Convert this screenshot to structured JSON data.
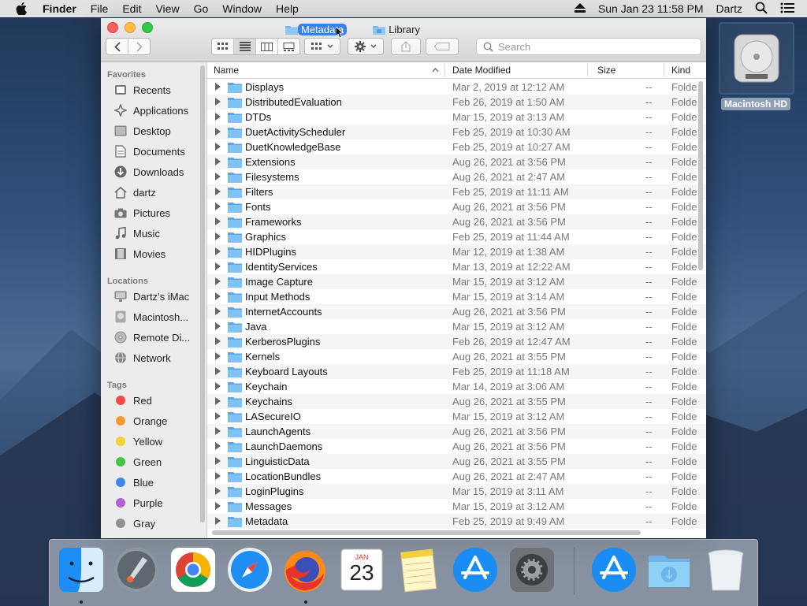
{
  "menubar": {
    "app": "Finder",
    "items": [
      "File",
      "Edit",
      "View",
      "Go",
      "Window",
      "Help"
    ],
    "clock": "Sun Jan 23  11:58 PM",
    "user": "Dartz"
  },
  "desktop": {
    "disk_label": "Macintosh HD"
  },
  "window": {
    "tabs": [
      {
        "label": "Metadata",
        "selected": true
      },
      {
        "label": "Library",
        "selected": false
      }
    ],
    "search_placeholder": "Search",
    "sidebar": {
      "favorites_header": "Favorites",
      "favorites": [
        {
          "label": "Recents",
          "icon": "clock-icon"
        },
        {
          "label": "Applications",
          "icon": "applications-icon"
        },
        {
          "label": "Desktop",
          "icon": "desktop-icon"
        },
        {
          "label": "Documents",
          "icon": "document-icon"
        },
        {
          "label": "Downloads",
          "icon": "download-icon"
        },
        {
          "label": "dartz",
          "icon": "home-icon"
        },
        {
          "label": "Pictures",
          "icon": "camera-icon"
        },
        {
          "label": "Music",
          "icon": "music-icon"
        },
        {
          "label": "Movies",
          "icon": "film-icon"
        }
      ],
      "locations_header": "Locations",
      "locations": [
        {
          "label": "Dartz’s iMac",
          "icon": "imac-icon"
        },
        {
          "label": "Macintosh...",
          "icon": "disk-icon"
        },
        {
          "label": "Remote Di...",
          "icon": "disc-icon"
        },
        {
          "label": "Network",
          "icon": "globe-icon"
        }
      ],
      "tags_header": "Tags",
      "tags": [
        {
          "label": "Red",
          "color": "#f64a4a"
        },
        {
          "label": "Orange",
          "color": "#f79a32"
        },
        {
          "label": "Yellow",
          "color": "#f4d232"
        },
        {
          "label": "Green",
          "color": "#48c342"
        },
        {
          "label": "Blue",
          "color": "#3f86f0"
        },
        {
          "label": "Purple",
          "color": "#b65ed6"
        },
        {
          "label": "Gray",
          "color": "#8f8f8f"
        }
      ]
    },
    "columns": {
      "name": "Name",
      "date": "Date Modified",
      "size": "Size",
      "kind": "Kind"
    },
    "files": [
      {
        "name": "Displays",
        "date": "Mar 2, 2019 at 12:12 AM",
        "size": "--",
        "kind": "Folde"
      },
      {
        "name": "DistributedEvaluation",
        "date": "Feb 26, 2019 at 1:50 AM",
        "size": "--",
        "kind": "Folde"
      },
      {
        "name": "DTDs",
        "date": "Mar 15, 2019 at 3:13 AM",
        "size": "--",
        "kind": "Folde"
      },
      {
        "name": "DuetActivityScheduler",
        "date": "Feb 25, 2019 at 10:30 AM",
        "size": "--",
        "kind": "Folde"
      },
      {
        "name": "DuetKnowledgeBase",
        "date": "Feb 25, 2019 at 10:27 AM",
        "size": "--",
        "kind": "Folde"
      },
      {
        "name": "Extensions",
        "date": "Aug 26, 2021 at 3:56 PM",
        "size": "--",
        "kind": "Folde"
      },
      {
        "name": "Filesystems",
        "date": "Aug 26, 2021 at 2:47 AM",
        "size": "--",
        "kind": "Folde"
      },
      {
        "name": "Filters",
        "date": "Feb 25, 2019 at 11:11 AM",
        "size": "--",
        "kind": "Folde"
      },
      {
        "name": "Fonts",
        "date": "Aug 26, 2021 at 3:56 PM",
        "size": "--",
        "kind": "Folde"
      },
      {
        "name": "Frameworks",
        "date": "Aug 26, 2021 at 3:56 PM",
        "size": "--",
        "kind": "Folde"
      },
      {
        "name": "Graphics",
        "date": "Feb 25, 2019 at 11:44 AM",
        "size": "--",
        "kind": "Folde"
      },
      {
        "name": "HIDPlugins",
        "date": "Mar 12, 2019 at 1:38 AM",
        "size": "--",
        "kind": "Folde"
      },
      {
        "name": "IdentityServices",
        "date": "Mar 13, 2019 at 12:22 AM",
        "size": "--",
        "kind": "Folde"
      },
      {
        "name": "Image Capture",
        "date": "Mar 15, 2019 at 3:12 AM",
        "size": "--",
        "kind": "Folde"
      },
      {
        "name": "Input Methods",
        "date": "Mar 15, 2019 at 3:14 AM",
        "size": "--",
        "kind": "Folde"
      },
      {
        "name": "InternetAccounts",
        "date": "Aug 26, 2021 at 3:56 PM",
        "size": "--",
        "kind": "Folde"
      },
      {
        "name": "Java",
        "date": "Mar 15, 2019 at 3:12 AM",
        "size": "--",
        "kind": "Folde"
      },
      {
        "name": "KerberosPlugins",
        "date": "Feb 26, 2019 at 12:47 AM",
        "size": "--",
        "kind": "Folde"
      },
      {
        "name": "Kernels",
        "date": "Aug 26, 2021 at 3:55 PM",
        "size": "--",
        "kind": "Folde"
      },
      {
        "name": "Keyboard Layouts",
        "date": "Feb 25, 2019 at 11:18 AM",
        "size": "--",
        "kind": "Folde"
      },
      {
        "name": "Keychain",
        "date": "Mar 14, 2019 at 3:06 AM",
        "size": "--",
        "kind": "Folde"
      },
      {
        "name": "Keychains",
        "date": "Aug 26, 2021 at 3:55 PM",
        "size": "--",
        "kind": "Folde"
      },
      {
        "name": "LASecureIO",
        "date": "Mar 15, 2019 at 3:12 AM",
        "size": "--",
        "kind": "Folde"
      },
      {
        "name": "LaunchAgents",
        "date": "Aug 26, 2021 at 3:56 PM",
        "size": "--",
        "kind": "Folde"
      },
      {
        "name": "LaunchDaemons",
        "date": "Aug 26, 2021 at 3:56 PM",
        "size": "--",
        "kind": "Folde"
      },
      {
        "name": "LinguisticData",
        "date": "Aug 26, 2021 at 3:55 PM",
        "size": "--",
        "kind": "Folde"
      },
      {
        "name": "LocationBundles",
        "date": "Aug 26, 2021 at 2:47 AM",
        "size": "--",
        "kind": "Folde"
      },
      {
        "name": "LoginPlugins",
        "date": "Mar 15, 2019 at 3:11 AM",
        "size": "--",
        "kind": "Folde"
      },
      {
        "name": "Messages",
        "date": "Mar 15, 2019 at 3:12 AM",
        "size": "--",
        "kind": "Folde"
      },
      {
        "name": "Metadata",
        "date": "Feb 25, 2019 at 9:49 AM",
        "size": "--",
        "kind": "Folde"
      }
    ]
  },
  "dock": {
    "calendar_month": "JAN",
    "calendar_day": "23",
    "apps": [
      {
        "name": "finder-icon",
        "running": true
      },
      {
        "name": "launchpad-icon",
        "running": false
      },
      {
        "name": "chrome-icon",
        "running": false
      },
      {
        "name": "safari-icon",
        "running": false
      },
      {
        "name": "firefox-icon",
        "running": true
      },
      {
        "name": "calendar-icon",
        "running": false
      },
      {
        "name": "notes-icon",
        "running": false
      },
      {
        "name": "app-store-icon",
        "running": false
      },
      {
        "name": "system-preferences-icon",
        "running": false
      }
    ]
  }
}
